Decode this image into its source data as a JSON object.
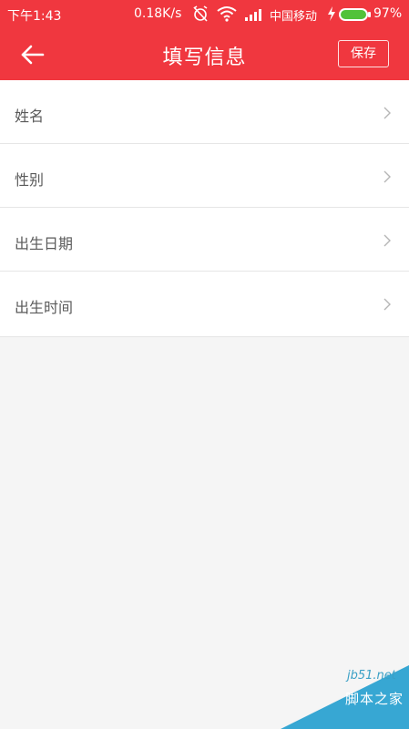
{
  "status_bar": {
    "time": "下午1:43",
    "speed": "0.18K/s",
    "carrier": "中国移动",
    "battery": "97%"
  },
  "header": {
    "title": "填写信息",
    "save_label": "保存",
    "back_icon": "arrow-left-icon"
  },
  "form": {
    "rows": [
      {
        "label": "姓名"
      },
      {
        "label": "性别"
      },
      {
        "label": "出生日期"
      },
      {
        "label": "出生时间"
      }
    ]
  },
  "watermark": {
    "url": "jb51.net",
    "text": "脚本之家"
  },
  "colors": {
    "brand": "#f0373f",
    "background": "#f5f5f5",
    "label": "#5a5a5a"
  }
}
